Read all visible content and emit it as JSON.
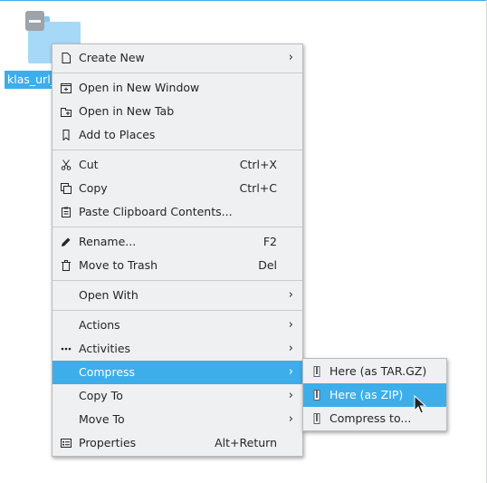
{
  "desktop": {
    "file_label": "klas_url_"
  },
  "menu": {
    "create_new": "Create New",
    "open_new_window": "Open in New Window",
    "open_new_tab": "Open in New Tab",
    "add_to_places": "Add to Places",
    "cut": "Cut",
    "cut_shortcut": "Ctrl+X",
    "copy": "Copy",
    "copy_shortcut": "Ctrl+C",
    "paste": "Paste Clipboard Contents...",
    "rename": "Rename...",
    "rename_shortcut": "F2",
    "move_to_trash": "Move to Trash",
    "trash_shortcut": "Del",
    "open_with": "Open With",
    "actions": "Actions",
    "activities": "Activities",
    "compress": "Compress",
    "copy_to": "Copy To",
    "move_to": "Move To",
    "properties": "Properties",
    "properties_shortcut": "Alt+Return",
    "submenu_arrow": "›"
  },
  "submenu": {
    "tar_gz": "Here (as TAR.GZ)",
    "zip": "Here (as ZIP)",
    "compress_to": "Compress to..."
  },
  "colors": {
    "highlight": "#3daee9",
    "menu_bg": "#eff0f1",
    "text": "#232629"
  },
  "icons": {
    "create_new": "new-document-icon",
    "open_new_window": "new-window-icon",
    "open_new_tab": "new-tab-icon",
    "add_to_places": "bookmark-icon",
    "cut": "scissors-icon",
    "copy": "copy-icon",
    "paste": "clipboard-icon",
    "rename": "pencil-icon",
    "trash": "trash-icon",
    "activities": "activities-icon",
    "properties": "properties-icon",
    "archive": "archive-icon"
  }
}
